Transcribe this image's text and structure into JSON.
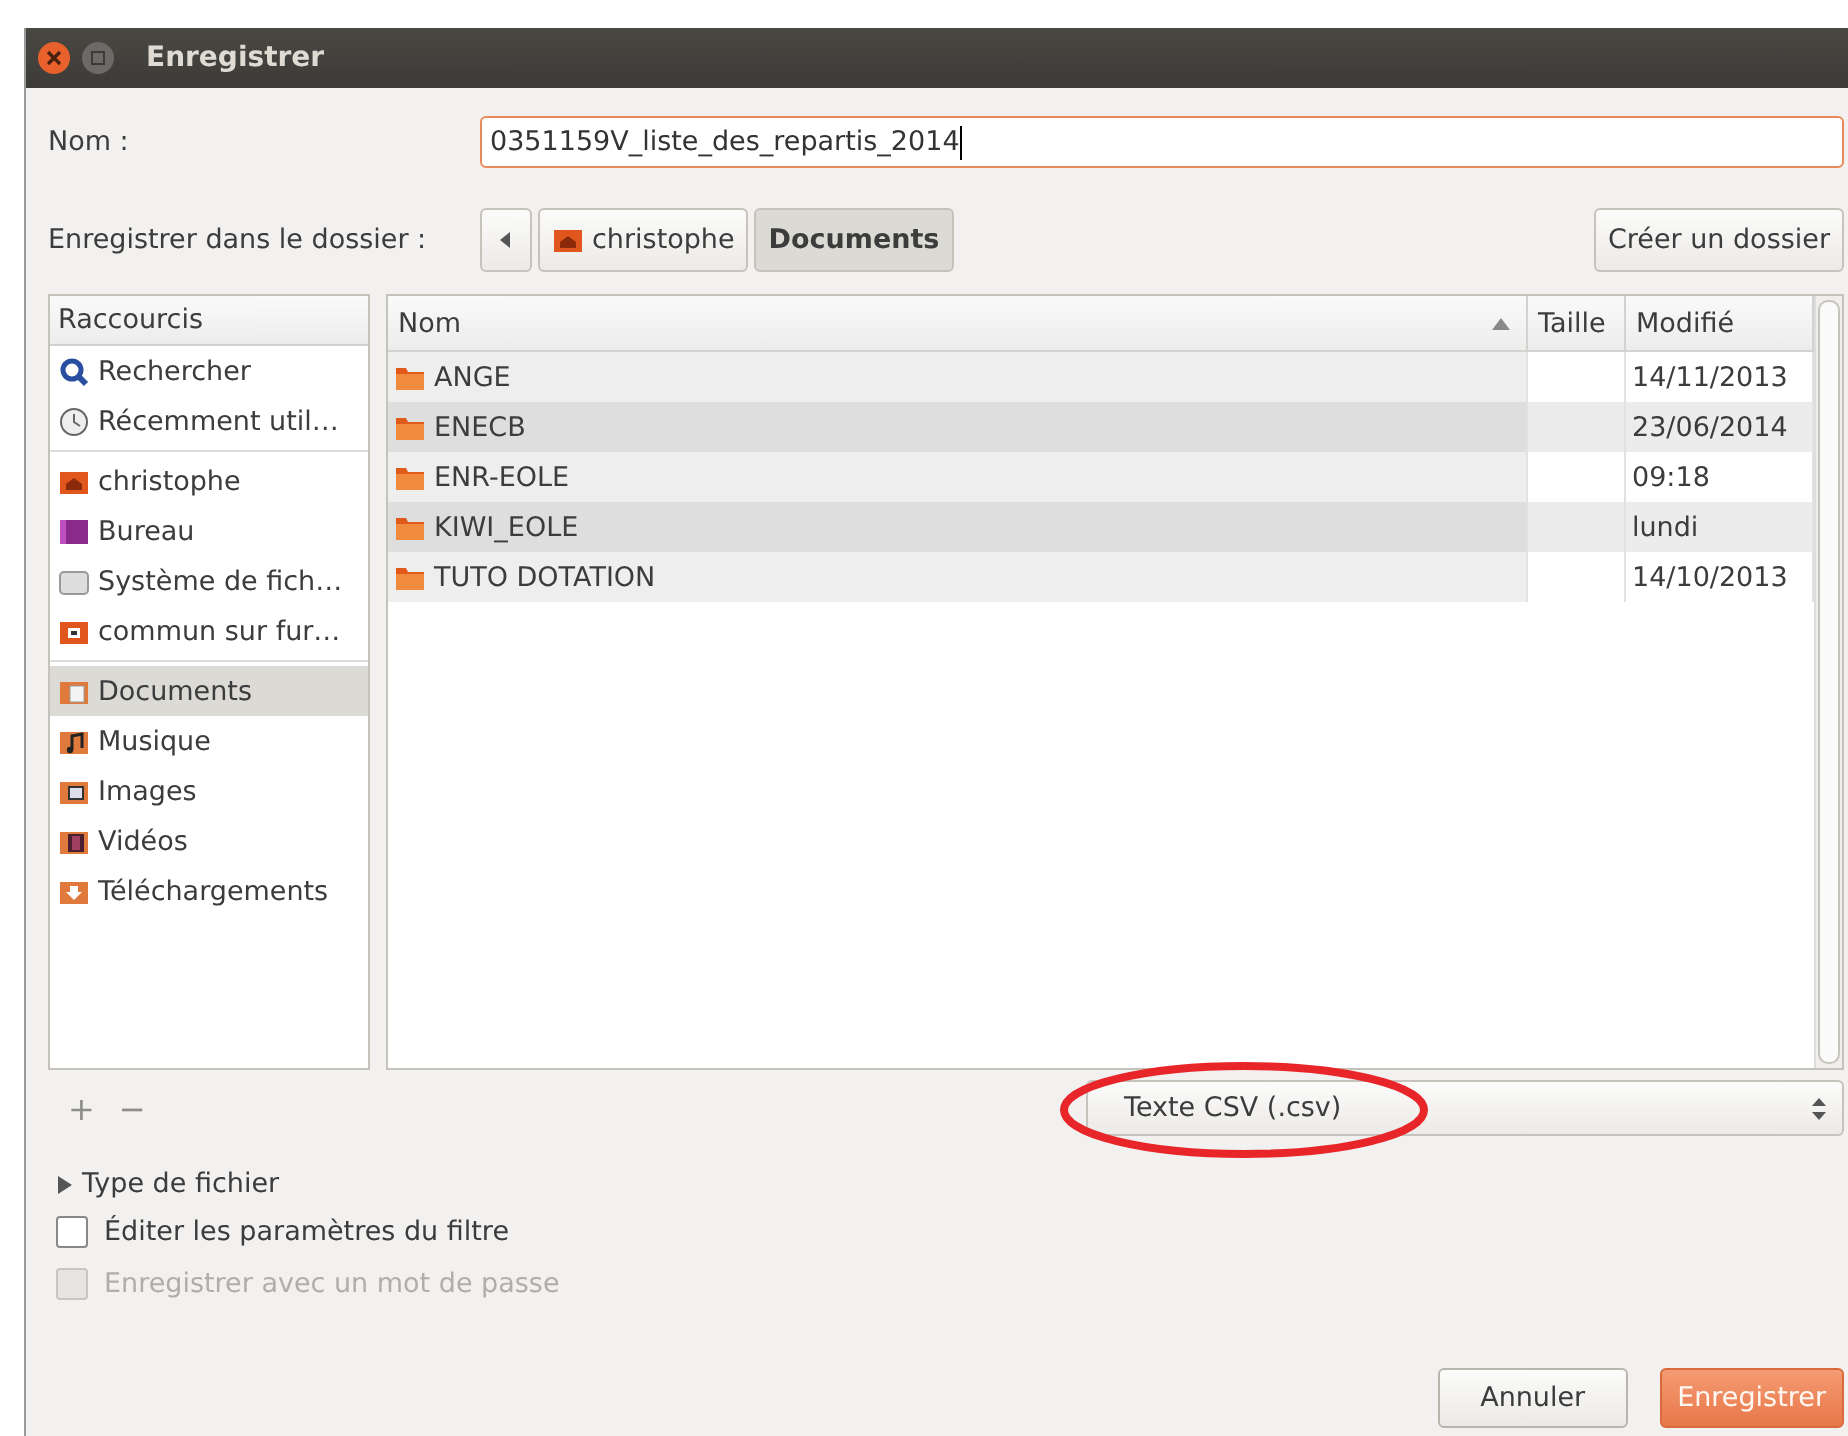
{
  "window": {
    "title": "Enregistrer"
  },
  "name_field": {
    "label": "Nom :",
    "value": "0351159V_liste_des_repartis_2014"
  },
  "folder": {
    "label": "Enregistrer dans le dossier :",
    "path": [
      {
        "label": "christophe",
        "kind": "home",
        "selected": false
      },
      {
        "label": "Documents",
        "kind": "plain",
        "selected": true
      }
    ],
    "create_button": "Créer un dossier"
  },
  "sidebar": {
    "header": "Raccourcis",
    "groups": [
      [
        {
          "label": "Rechercher",
          "kind": "search",
          "selected": false
        },
        {
          "label": "Récemment util…",
          "kind": "clock",
          "selected": false
        }
      ],
      [
        {
          "label": "christophe",
          "kind": "home",
          "selected": false
        },
        {
          "label": "Bureau",
          "kind": "desktop",
          "selected": false
        },
        {
          "label": "Système de fich…",
          "kind": "drive",
          "selected": false
        },
        {
          "label": "commun sur fur…",
          "kind": "share",
          "selected": false
        }
      ],
      [
        {
          "label": "Documents",
          "kind": "documents",
          "selected": true
        },
        {
          "label": "Musique",
          "kind": "music",
          "selected": false
        },
        {
          "label": "Images",
          "kind": "images",
          "selected": false
        },
        {
          "label": "Vidéos",
          "kind": "videos",
          "selected": false
        },
        {
          "label": "Téléchargements",
          "kind": "downloads",
          "selected": false
        }
      ]
    ]
  },
  "table": {
    "columns": [
      "Nom",
      "Taille",
      "Modifié"
    ],
    "rows": [
      {
        "name": "ANGE",
        "modified": "14/11/2013"
      },
      {
        "name": "ENECB",
        "modified": "23/06/2014"
      },
      {
        "name": "ENR-EOLE",
        "modified": "09:18"
      },
      {
        "name": "KIWI_EOLE",
        "modified": "lundi"
      },
      {
        "name": "TUTO DOTATION",
        "modified": "14/10/2013"
      }
    ]
  },
  "bookmark_buttons": [
    {
      "label": "+",
      "disabled": true
    },
    {
      "label": "−",
      "disabled": true
    }
  ],
  "filter": {
    "value": "Texte CSV (.csv)"
  },
  "file_type_expander": {
    "label": "Type de fichier",
    "expanded": false
  },
  "options": [
    {
      "label": "Éditer les paramètres du filtre",
      "checked": false,
      "disabled": false
    },
    {
      "label": "Enregistrer avec un mot de passe",
      "checked": false,
      "disabled": true
    }
  ],
  "buttons": [
    {
      "label": "Annuler",
      "kind": "normal"
    },
    {
      "label": "Enregistrer",
      "kind": "default"
    }
  ]
}
